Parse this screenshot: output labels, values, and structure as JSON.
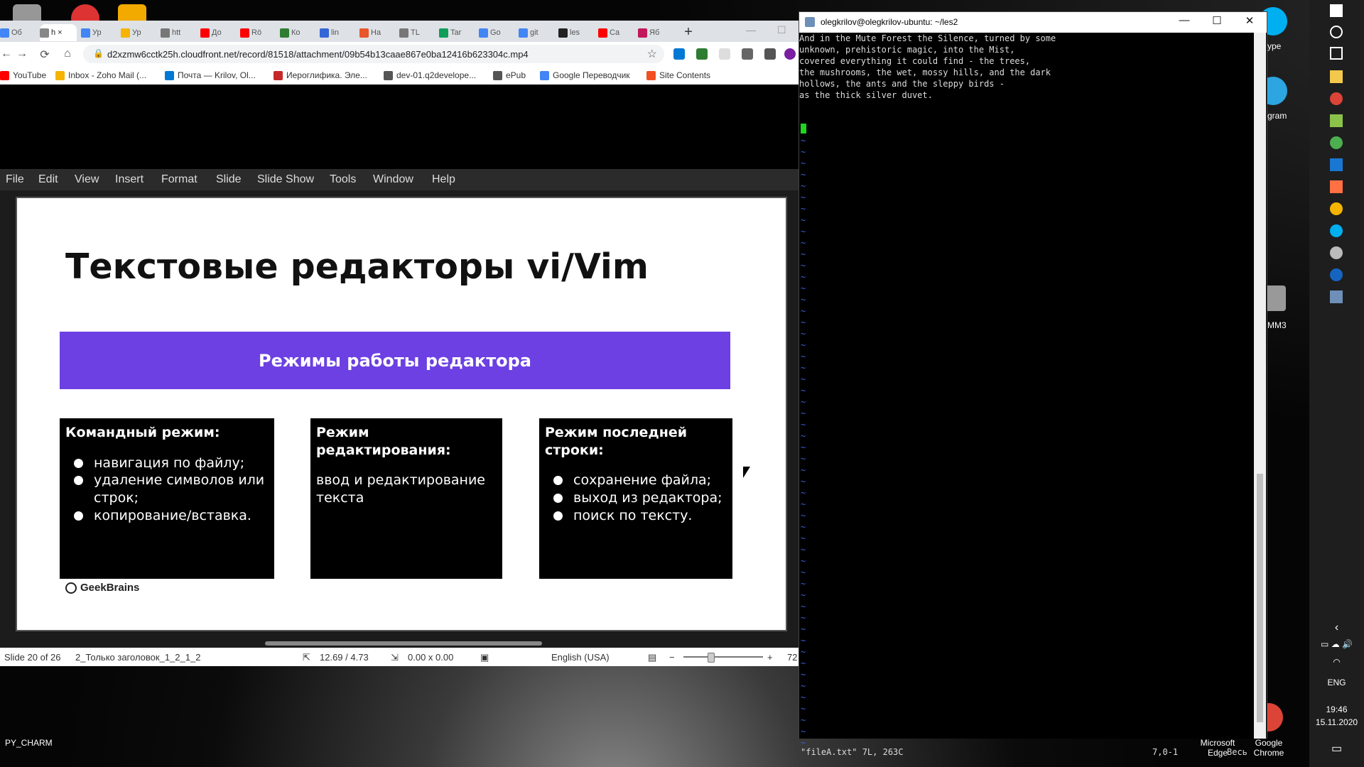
{
  "chrome": {
    "tabs": [
      {
        "label": "Об",
        "color": "#4285f4"
      },
      {
        "label": "h",
        "color": "#888888",
        "active": true
      },
      {
        "label": "Ур",
        "color": "#4285f4"
      },
      {
        "label": "Ур",
        "color": "#f4b400"
      },
      {
        "label": "htt",
        "color": "#777777"
      },
      {
        "label": "До",
        "color": "#ff0000"
      },
      {
        "label": "Rö",
        "color": "#ff0000"
      },
      {
        "label": "Ко",
        "color": "#2e7d32"
      },
      {
        "label": "lin",
        "color": "#3367d6"
      },
      {
        "label": "На",
        "color": "#e8572a"
      },
      {
        "label": "TL",
        "color": "#777777"
      },
      {
        "label": "Tar",
        "color": "#0f9d58"
      },
      {
        "label": "Go",
        "color": "#4285f4"
      },
      {
        "label": "git",
        "color": "#4285f4"
      },
      {
        "label": "les",
        "color": "#222222"
      },
      {
        "label": "Ca",
        "color": "#ff0000"
      },
      {
        "label": "Яб",
        "color": "#c2185b"
      }
    ],
    "url": "d2xzmw6cctk25h.cloudfront.net/record/81518/attachment/09b54b13caae867e0ba12416b623304c.mp4",
    "bookmarks": [
      {
        "label": "YouTube",
        "color": "#ff0000"
      },
      {
        "label": "Inbox - Zoho Mail (...",
        "color": "#f4b400"
      },
      {
        "label": "Почта — Krilov, Ol...",
        "color": "#0078d4"
      },
      {
        "label": "Иероглифика. Эле...",
        "color": "#c62828"
      },
      {
        "label": "dev-01.q2develope...",
        "color": "#555555"
      },
      {
        "label": "ePub",
        "color": "#555555"
      },
      {
        "label": "Google Переводчик",
        "color": "#4285f4"
      },
      {
        "label": "Site Contents",
        "color": "#f25022"
      }
    ]
  },
  "impress": {
    "menu": [
      "File",
      "Edit",
      "View",
      "Insert",
      "Format",
      "Slide",
      "Slide Show",
      "Tools",
      "Window",
      "Help"
    ],
    "slide": {
      "title": "Текстовые редакторы vi/Vim",
      "banner": "Режимы работы редактора",
      "boxes": [
        {
          "title": "Командный режим:",
          "items": [
            "навигация по файлу;",
            "удаление символов или строк;",
            "копирование/вставка."
          ]
        },
        {
          "title": "Режим редактирования:",
          "text": "ввод и редактирование текста"
        },
        {
          "title": "Режим последней строки:",
          "items": [
            "сохранение файла;",
            "выход из редактора;",
            "поиск по тексту."
          ]
        }
      ],
      "logo": "GeekBrains"
    },
    "status": {
      "slide": "Slide 20 of 26",
      "layout": "2_Только заголовок_1_2_1_2",
      "position": "12.69 / 4.73",
      "size": "0.00 x 0.00",
      "language": "English (USA)",
      "zoom": "72"
    }
  },
  "terminal": {
    "title": "olegkrilov@olegkrilov-ubuntu: ~/les2",
    "lines": [
      "And in the Mute Forest the Silence, turned by some",
      "unknown, prehistoric magic, into the Mist,",
      "covered everything it could find - the trees,",
      "the mushrooms, the wet, mossy hills, and the dark",
      "hollows, the ants and the sleppy birds -",
      "as the thick silver duvet."
    ],
    "status_left": "\"fileA.txt\" 7L, 263C",
    "status_pos": "7,0-1",
    "status_right": "Весь"
  },
  "taskbar": {
    "lang": "ENG",
    "time": "19:46",
    "date": "15.11.2020",
    "edge_label": "Microsoft Edge",
    "chrome_label": "Google Chrome"
  },
  "desktop": {
    "pycharm_label": "PY_CHARM",
    "skype_label": "ype",
    "telegram_label": "gram",
    "mm3_label": "MM3"
  }
}
